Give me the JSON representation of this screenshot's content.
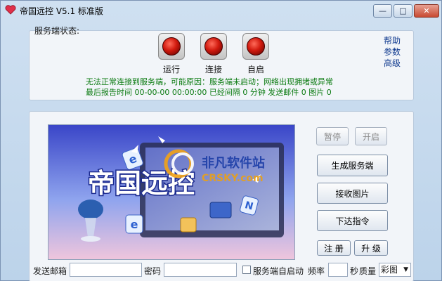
{
  "window": {
    "title": "帝国远控 V5.1 标准版",
    "minimize_glyph": "—",
    "maximize_glyph": "□",
    "close_glyph": "✕"
  },
  "status": {
    "label": "服务端状态:",
    "lamps": [
      {
        "label": "运行",
        "color": "#d11a0e"
      },
      {
        "label": "连接",
        "color": "#d11a0e"
      },
      {
        "label": "自启",
        "color": "#d11a0e"
      }
    ],
    "links": [
      "帮助",
      "参数",
      "高级"
    ],
    "message_line1": "无法正常连接到服务端，可能原因：服务端未启动；网络出现拥堵或异常",
    "message_line2": "最后报告时间 00-00-00 00:00:00 已经间隔 0 分钟 发送邮件 0 图片 0"
  },
  "banner": {
    "logo_text": "帝国远控",
    "watermark_cn": "非凡软件站",
    "watermark_en": "CRSKY.com"
  },
  "actions": {
    "pause": "暂停",
    "start": "开启",
    "generate": "生成服务端",
    "receive": "接收图片",
    "command": "下达指令",
    "register": "注 册",
    "upgrade": "升 级"
  },
  "form": {
    "email_label": "发送邮箱",
    "email_value": "",
    "password_label": "密码",
    "password_value": "",
    "autostart_label": "服务端自启动",
    "frequency_label": "频率",
    "frequency_value": "",
    "seconds_label": "秒",
    "quality_label": "质量",
    "quality_value": "彩图"
  },
  "colors": {
    "accent": "#0a7a10",
    "link": "#103a8f",
    "lamp_red": "#d11a0e"
  }
}
